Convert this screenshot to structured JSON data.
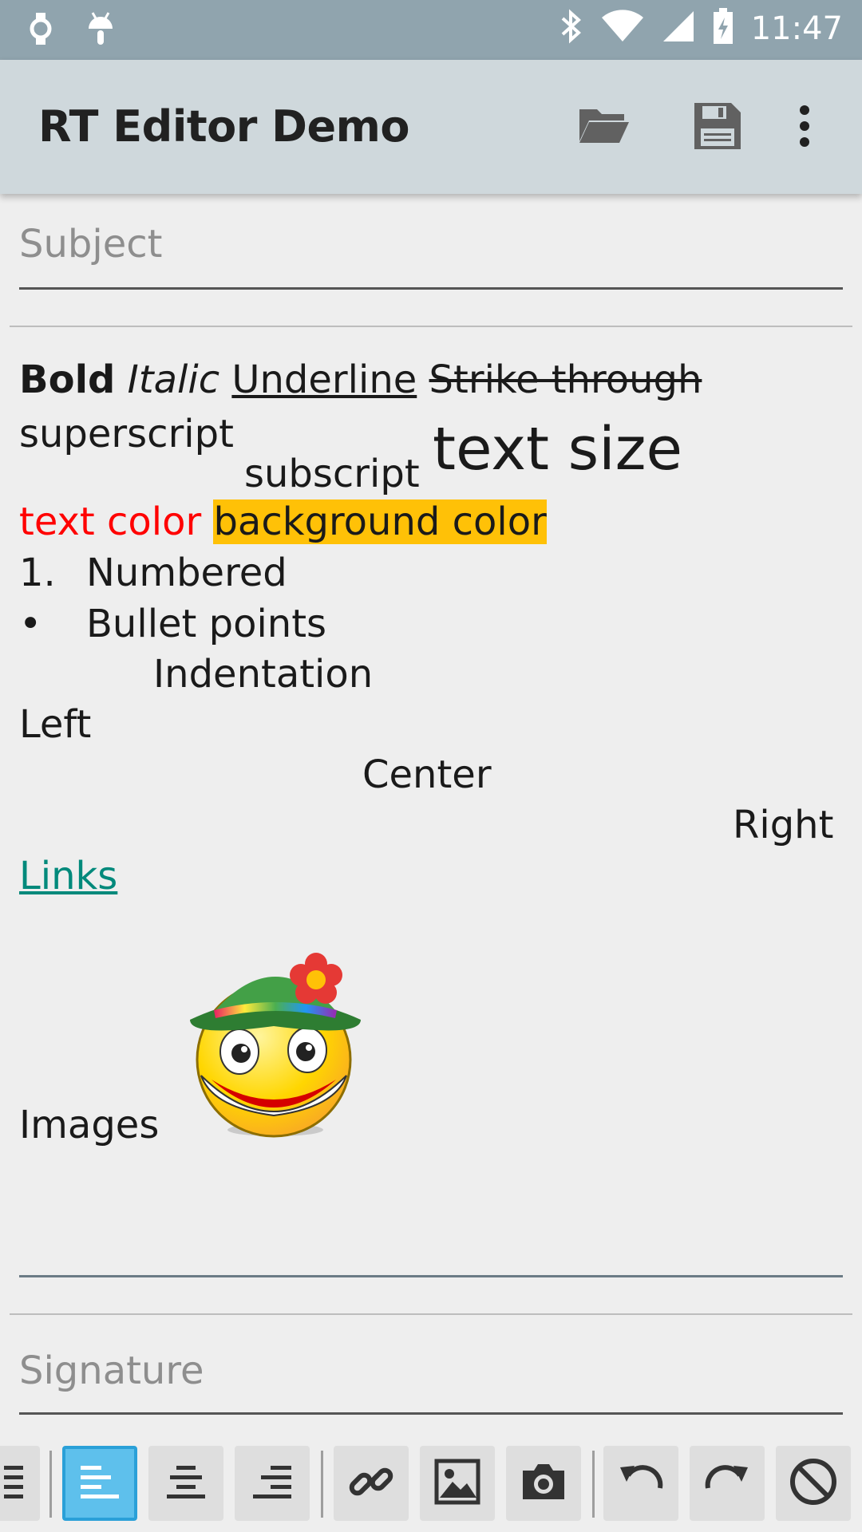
{
  "status_bar": {
    "time": "11:47",
    "left_icons": [
      "watch-icon",
      "android-icon"
    ],
    "right_icons": [
      "bluetooth-icon",
      "wifi-icon",
      "signal-icon",
      "battery-charging-icon"
    ]
  },
  "app_bar": {
    "title": "RT Editor Demo",
    "actions": [
      "folder-open-icon",
      "save-icon",
      "more-vert-icon"
    ]
  },
  "subject": {
    "placeholder": "Subject"
  },
  "content": {
    "bold": "Bold",
    "italic": "Italic",
    "underline": "Underline",
    "strike": "Strike through",
    "superscript": "superscript",
    "subscript": "subscript",
    "text_size": "text size",
    "text_color": "text color",
    "background_color": "background color",
    "numbered_marker": "1.",
    "numbered": "Numbered",
    "bullet_marker": "•",
    "bullet": "Bullet points",
    "indentation": "Indentation",
    "left": "Left",
    "center": "Center",
    "right": "Right",
    "links": "Links",
    "images": "Images",
    "text_color_value": "#ff0000",
    "background_color_value": "#ffc107",
    "link_color": "#00897b"
  },
  "signature": {
    "placeholder": "Signature"
  },
  "toolbar": {
    "buttons": [
      "bullet-list-icon",
      "align-left-icon",
      "align-center-icon",
      "align-right-icon",
      "link-icon",
      "image-icon",
      "camera-icon",
      "undo-icon",
      "redo-icon",
      "clear-format-icon"
    ],
    "active": "align-left-icon",
    "accent": "#5ec0ec"
  }
}
